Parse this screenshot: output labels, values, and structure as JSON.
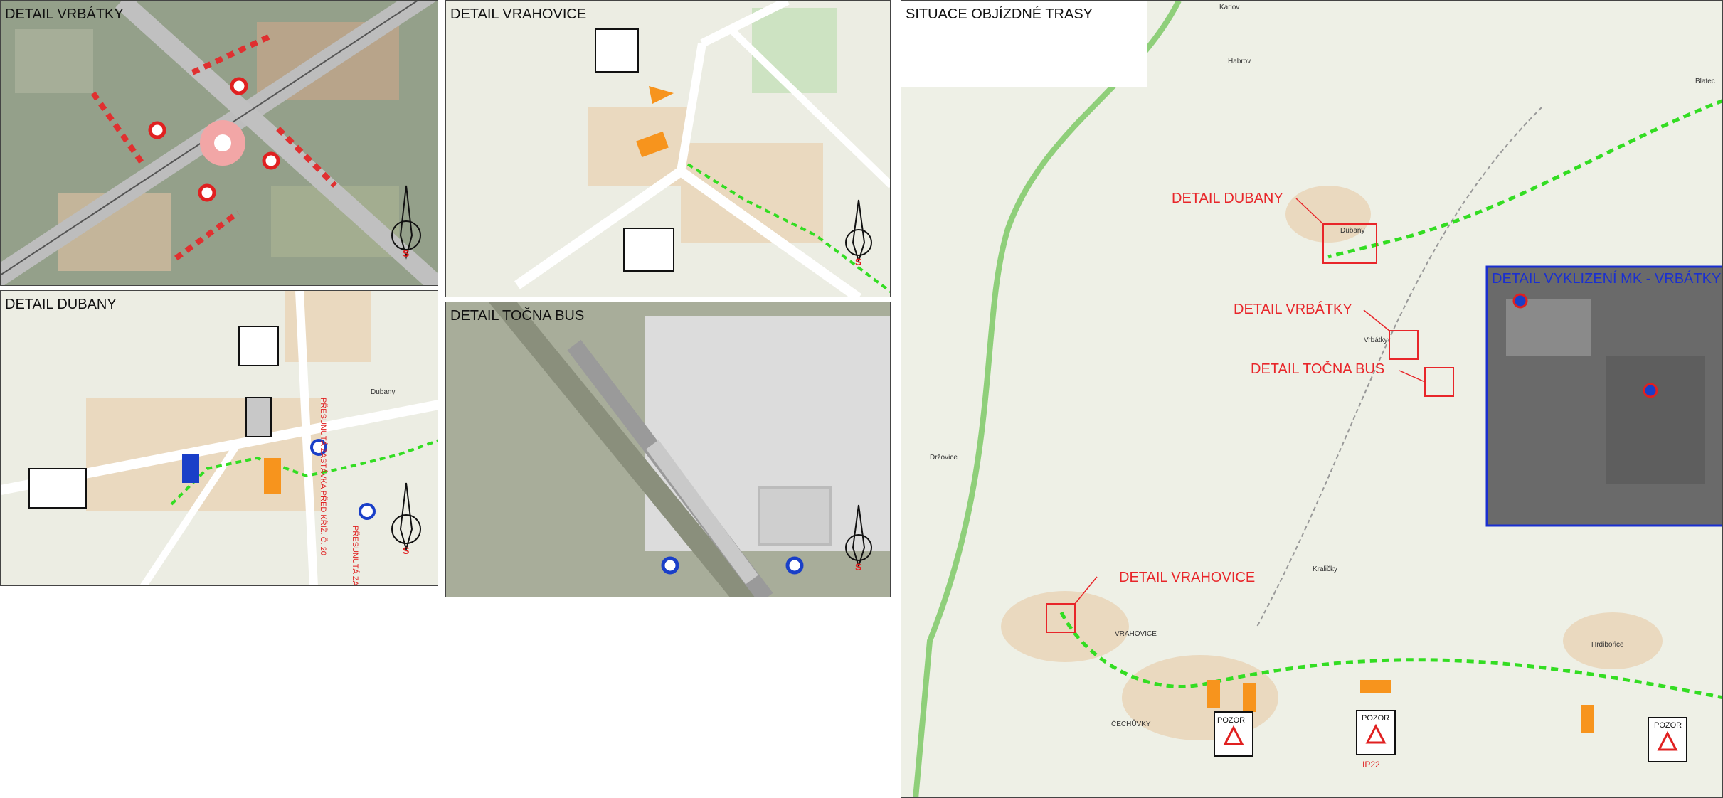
{
  "panels": {
    "vrbatky": {
      "title": "DETAIL VRBÁTKY",
      "compass": "S"
    },
    "vrahovice": {
      "title": "DETAIL VRAHOVICE",
      "compass": "S"
    },
    "dubany": {
      "title": "DETAIL DUBANY",
      "compass": "S",
      "village": "Dubany",
      "note1": "PŘESUNUTÁ ZASTÁVKA PŘED KŘIŽ. Č. 20",
      "note2": "PŘESUNUTÁ ZASTÁVKA PŘED"
    },
    "tocna": {
      "title": "DETAIL TOČNA BUS",
      "compass": "S"
    },
    "situace": {
      "title": "SITUACE OBJÍZDNÉ TRASY",
      "callouts": {
        "dubany": "DETAIL DUBANY",
        "vrbatky": "DETAIL VRBÁTKY",
        "tocna": "DETAIL TOČNA BUS",
        "vrahovice": "DETAIL VRAHOVICE"
      },
      "inset_title": "DETAIL VYKLIZENÍ MK - VRBÁTKY",
      "places": {
        "karlov": "Karlov",
        "habrov": "Habrov",
        "blatec": "Blatec",
        "dubany": "Dubany",
        "vrbatky": "Vrbátky",
        "drzovice": "Držovice",
        "kralicky": "Kraličky",
        "vrahovice": "VRAHOVICE",
        "cechuvky": "ČECHŮVKY",
        "hrdibořice": "Hrdibořice"
      },
      "signs": {
        "pozor": "POZOR",
        "ip22": "IP22"
      }
    }
  },
  "colors": {
    "detour": "#33dd22",
    "callout": "#e8262a",
    "inset": "#1a2fd0",
    "sign_orange": "#f7941d"
  }
}
